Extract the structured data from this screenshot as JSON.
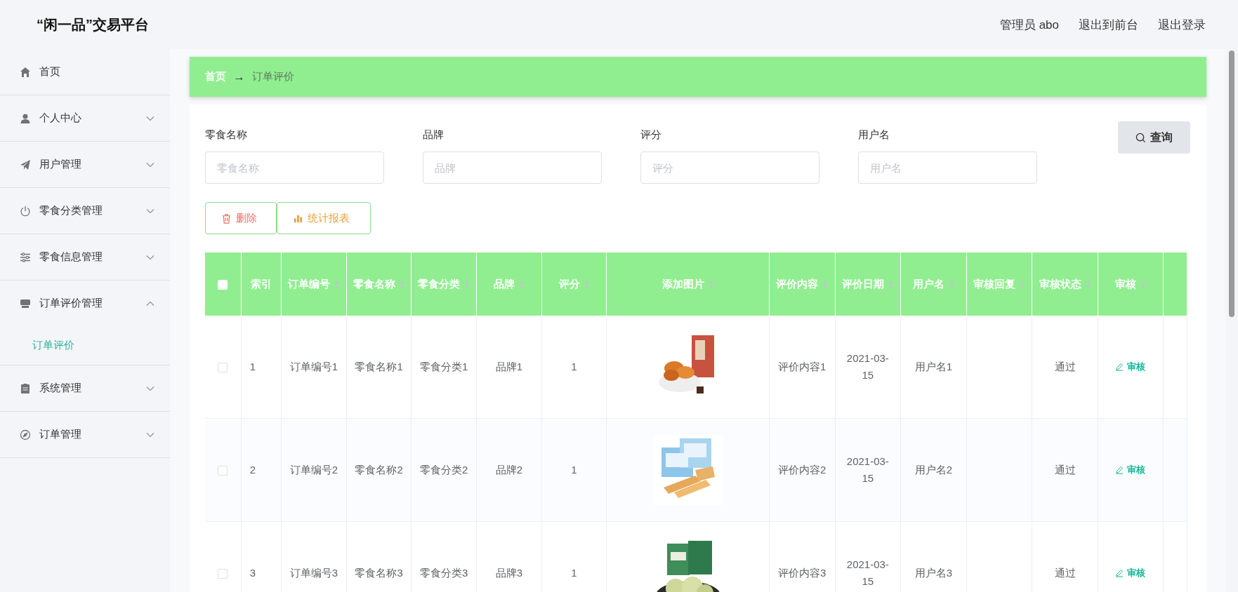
{
  "header": {
    "title": "“闲一品”交易平台",
    "links": [
      "管理员 abo",
      "退出到前台",
      "退出登录"
    ]
  },
  "sidebar": {
    "items": [
      {
        "label": "首页",
        "kind": "link"
      },
      {
        "label": "个人中心",
        "kind": "menu",
        "expanded": false
      },
      {
        "label": "用户管理",
        "kind": "menu",
        "expanded": false
      },
      {
        "label": "零食分类管理",
        "kind": "menu",
        "expanded": false
      },
      {
        "label": "零食信息管理",
        "kind": "menu",
        "expanded": false
      },
      {
        "label": "订单评价管理",
        "kind": "menu",
        "expanded": true,
        "children": [
          {
            "label": "订单评价",
            "selected": true
          }
        ]
      },
      {
        "label": "系统管理",
        "kind": "menu",
        "expanded": false
      },
      {
        "label": "订单管理",
        "kind": "menu",
        "expanded": false
      }
    ]
  },
  "breadcrumb": {
    "items": [
      "首页",
      "订单评价"
    ],
    "separator": "→"
  },
  "search": {
    "fields": [
      {
        "label": "零食名称",
        "placeholder": "零食名称"
      },
      {
        "label": "品牌",
        "placeholder": "品牌"
      },
      {
        "label": "评分",
        "placeholder": "评分"
      },
      {
        "label": "用户名",
        "placeholder": "用户名"
      }
    ],
    "button": "查询"
  },
  "actions": [
    {
      "label": "删除",
      "kind": "delete"
    },
    {
      "label": "统计报表",
      "kind": "report"
    }
  ],
  "table": {
    "all_selected": false,
    "columns": [
      {
        "label": "索引",
        "sortable": false
      },
      {
        "label": "订单编号",
        "sortable": true
      },
      {
        "label": "零食名称",
        "sortable": true
      },
      {
        "label": "零食分类",
        "sortable": true
      },
      {
        "label": "品牌",
        "sortable": true
      },
      {
        "label": "评分",
        "sortable": true
      },
      {
        "label": "添加图片",
        "sortable": true
      },
      {
        "label": "评价内容",
        "sortable": true
      },
      {
        "label": "评价日期",
        "sortable": true
      },
      {
        "label": "用户名",
        "sortable": true
      },
      {
        "label": "审核回复",
        "sortable": true
      },
      {
        "label": "审核状态",
        "sortable": true
      },
      {
        "label": "审核",
        "sortable": true
      }
    ],
    "rows": [
      {
        "selected": false,
        "index": "1",
        "order_no": "订单编号1",
        "snack_name": "零食名称1",
        "category": "零食分类1",
        "brand": "品牌1",
        "rating": "1",
        "review": "评价内容1",
        "date": "2021-03-15",
        "username": "用户名1",
        "status": "通过",
        "action": "审核"
      },
      {
        "selected": false,
        "index": "2",
        "order_no": "订单编号2",
        "snack_name": "零食名称2",
        "category": "零食分类2",
        "brand": "品牌2",
        "rating": "1",
        "review": "评价内容2",
        "date": "2021-03-15",
        "username": "用户名2",
        "status": "通过",
        "action": "审核"
      },
      {
        "selected": false,
        "index": "3",
        "order_no": "订单编号3",
        "snack_name": "零食名称3",
        "category": "零食分类3",
        "brand": "品牌3",
        "rating": "1",
        "review": "评价内容3",
        "date": "2021-03-15",
        "username": "用户名3",
        "status": "通过",
        "action": "审核"
      }
    ]
  }
}
